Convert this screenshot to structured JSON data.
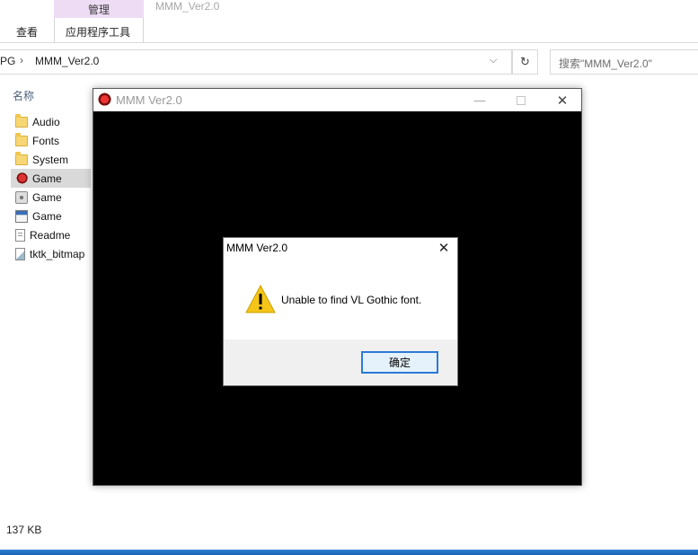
{
  "explorer": {
    "ribbon": {
      "context_tab_header": "管理",
      "context_tab": "应用程序工具",
      "view_tab": "查看",
      "window_title": "MMM_Ver2.0"
    },
    "address": {
      "prev_segment": "PG",
      "current": "MMM_Ver2.0",
      "search_placeholder": "搜索\"MMM_Ver2.0\""
    },
    "column_header": "名称",
    "files": [
      {
        "name": "Audio",
        "icon": "folder-icon"
      },
      {
        "name": "Fonts",
        "icon": "folder-icon"
      },
      {
        "name": "System",
        "icon": "folder-icon"
      },
      {
        "name": "Game",
        "icon": "game-exe-icon",
        "selected": true
      },
      {
        "name": "Game",
        "icon": "config-file-icon"
      },
      {
        "name": "Game",
        "icon": "application-icon"
      },
      {
        "name": "Readme",
        "icon": "text-document-icon"
      },
      {
        "name": "tktk_bitmap",
        "icon": "image-document-icon"
      }
    ],
    "status_size": "137 KB"
  },
  "game_window": {
    "title": "MMM Ver2.0"
  },
  "message_box": {
    "title": "MMM Ver2.0",
    "message": "Unable to find VL Gothic font.",
    "ok_label": "确定"
  },
  "colors": {
    "context_tab": "#eedcf5",
    "selection": "#d9d9d9",
    "ok_button_border": "#2c7ad6",
    "warning_yellow": "#f5c518",
    "taskbar": "#1b64b8"
  }
}
